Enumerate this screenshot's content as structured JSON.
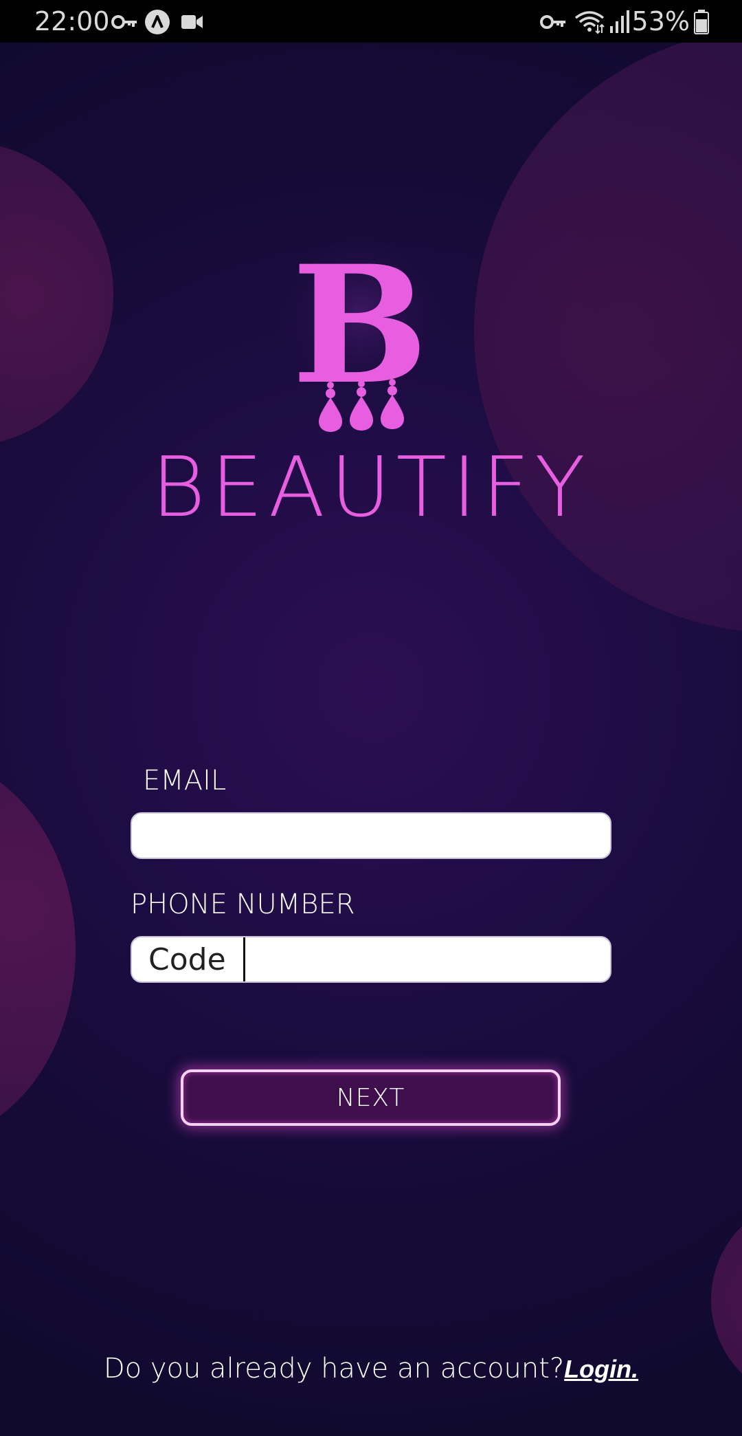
{
  "status_bar": {
    "time": "22:00",
    "battery": "53%",
    "icons_left": [
      "key-icon",
      "accessibility-icon",
      "video-camera-icon"
    ],
    "icons_right": [
      "key-icon",
      "wifi-icon",
      "signal-icon",
      "battery-icon"
    ]
  },
  "brand": {
    "logo_letter": "B",
    "name": "BEAUTIFY",
    "color": "#e85ee0"
  },
  "form": {
    "email_label": "EMAIL",
    "email_value": "",
    "phone_label": "PHONE NUMBER",
    "phone_code_placeholder": "Code",
    "phone_number_value": ""
  },
  "actions": {
    "next_label": "NEXT"
  },
  "footer": {
    "prompt": "Do you already have an account?",
    "login_label": "Login."
  },
  "colors": {
    "background": "#150b36",
    "accent": "#e85ee0",
    "button_bg": "#3e0f4c"
  }
}
